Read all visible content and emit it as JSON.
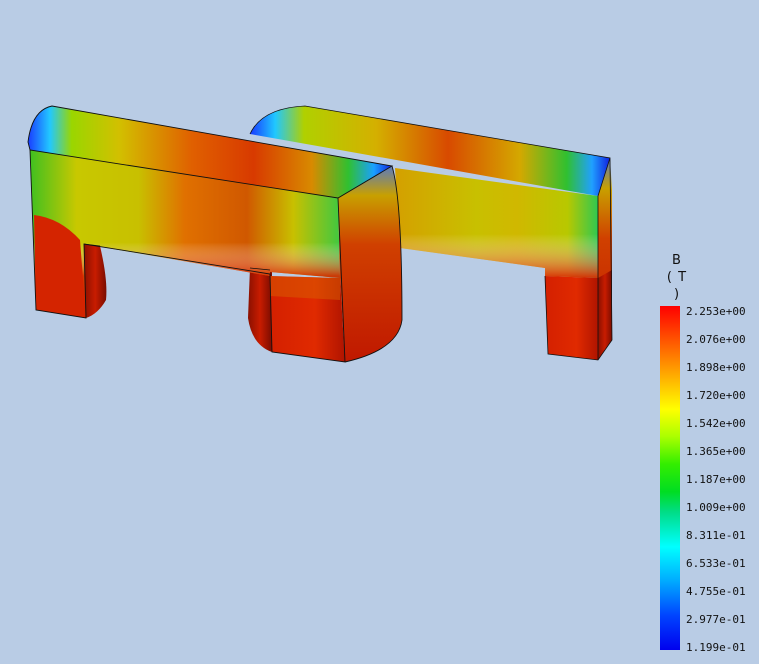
{
  "legend": {
    "title_line1": "B",
    "title_line2": "( T )",
    "ticks": [
      "2.253e+00",
      "2.076e+00",
      "1.898e+00",
      "1.720e+00",
      "1.542e+00",
      "1.365e+00",
      "1.187e+00",
      "1.009e+00",
      "8.311e-01",
      "6.533e-01",
      "4.755e-01",
      "2.977e-01",
      "1.199e-01"
    ],
    "colors": {
      "max": "#ff0000",
      "high": "#ff8800",
      "mid_high": "#ffff00",
      "mid": "#33ee00",
      "mid_low": "#00ffff",
      "min": "#0000ee"
    }
  },
  "viewport": {
    "background": "#b9cce5",
    "model": "two U-shaped magnetic cores with flux density contour"
  }
}
